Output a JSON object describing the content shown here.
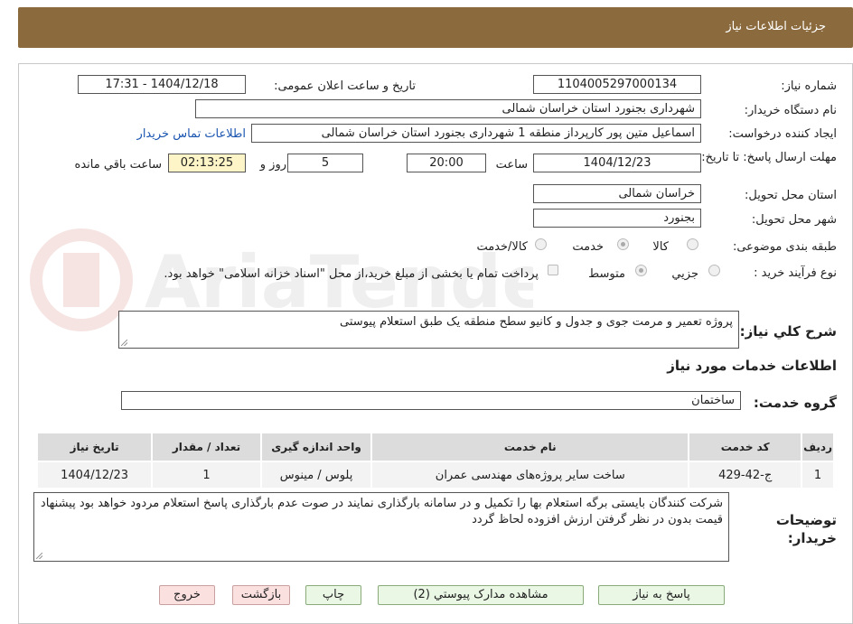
{
  "header": {
    "title": "جزئیات اطلاعات نیاز"
  },
  "watermark": {
    "text": "AriaTender.neT"
  },
  "form": {
    "need_number": {
      "label": "شماره نیاز:",
      "value": "1104005297000134"
    },
    "announce_datetime": {
      "label": "تاریخ و ساعت اعلان عمومی:",
      "value": "1404/12/18 - 17:31"
    },
    "buyer_org": {
      "label": "نام دستگاه خریدار:",
      "value": "شهرداری بجنورد استان خراسان شمالی"
    },
    "requester": {
      "label": "ایجاد کننده درخواست:",
      "value": "اسماعیل متین پور کارپرداز منطقه 1 شهرداری بجنورد استان خراسان شمالی"
    },
    "contact_link": "اطلاعات تماس خریدار",
    "deadline": {
      "label": "مهلت ارسال پاسخ: تا تاریخ:",
      "date": "1404/12/23",
      "time_label": "ساعت",
      "time": "20:00",
      "days": "5",
      "days_label": "روز و",
      "remaining": "02:13:25",
      "remaining_label": "ساعت باقي مانده"
    },
    "delivery_province": {
      "label": "استان محل تحویل:",
      "value": "خراسان شمالی"
    },
    "delivery_city": {
      "label": "شهر محل تحویل:",
      "value": "بجنورد"
    },
    "category": {
      "label": "طبقه بندی موضوعی:",
      "options": [
        "کالا",
        "خدمت",
        "کالا/خدمت"
      ],
      "selected": "خدمت"
    },
    "purchase_type": {
      "label": "نوع فرآیند خرید :",
      "options": [
        "جزيي",
        "متوسط"
      ],
      "selected": "متوسط",
      "payment_note": "پرداخت تمام یا بخشی از مبلغ خرید،از محل \"اسناد خزانه اسلامی\" خواهد بود."
    },
    "description": {
      "label": "شرح كلي نياز:",
      "value": "پروژه تعمیر و مرمت جوی و جدول و کانیو سطح منطقه یک طبق استعلام پیوستی"
    },
    "services_title": "اطلاعات خدمات مورد نياز",
    "service_group": {
      "label": "گروه خدمت:",
      "value": "ساختمان"
    }
  },
  "table": {
    "headers": [
      "رديف",
      "کد خدمت",
      "نام خدمت",
      "واحد اندازه گیری",
      "تعداد / مقدار",
      "تاریخ نیاز"
    ],
    "rows": [
      [
        "1",
        "ج-42-429",
        "ساخت سایر پروژه‌های مهندسی عمران",
        "پلوس / مینوس",
        "1",
        "1404/12/23"
      ]
    ]
  },
  "buyer_notes": {
    "label": "توضيحات خريدار:",
    "value": "شرکت کنندگان بایستی برگه استعلام بها را تکمیل و در سامانه بارگذاری نمایند در صوت عدم بارگذاری پاسخ استعلام مردود خواهد بود پیشنهاد قیمت بدون در نظر گرفتن ارزش افزوده لحاظ گردد"
  },
  "buttons": {
    "reply": "پاسخ به نیاز",
    "attachments": "مشاهده مدارک پیوستي (2)",
    "print": "چاپ",
    "back": "بازگشت",
    "exit": "خروج"
  },
  "colors": {
    "header": "#8b6a3d",
    "link": "#1a55b0",
    "remaining_bg": "#fdf5c7"
  }
}
